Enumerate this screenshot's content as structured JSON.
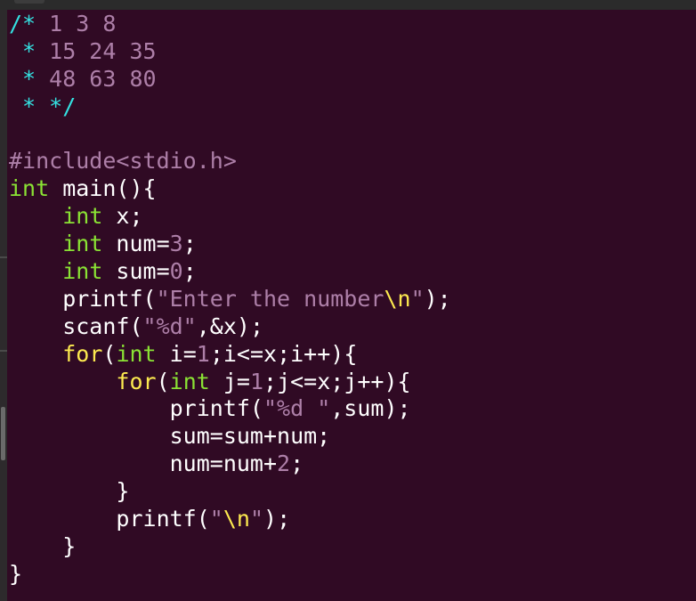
{
  "editor": {
    "lines": [
      [
        {
          "t": "/* ",
          "c": "comment"
        },
        {
          "t": "1 3 8",
          "c": "num"
        }
      ],
      [
        {
          "t": " * ",
          "c": "comment"
        },
        {
          "t": "15 24 35",
          "c": "num"
        }
      ],
      [
        {
          "t": " * ",
          "c": "comment"
        },
        {
          "t": "48 63 80",
          "c": "num"
        }
      ],
      [
        {
          "t": " * */",
          "c": "comment"
        }
      ],
      [
        {
          "t": "",
          "c": "plain"
        }
      ],
      [
        {
          "t": "#include",
          "c": "pre"
        },
        {
          "t": "<stdio.h>",
          "c": "str"
        }
      ],
      [
        {
          "t": "int",
          "c": "kw"
        },
        {
          "t": " main(){",
          "c": "plain"
        }
      ],
      [
        {
          "t": "    ",
          "c": "plain"
        },
        {
          "t": "int",
          "c": "kw"
        },
        {
          "t": " x;",
          "c": "plain"
        }
      ],
      [
        {
          "t": "    ",
          "c": "plain"
        },
        {
          "t": "int",
          "c": "kw"
        },
        {
          "t": " num=",
          "c": "plain"
        },
        {
          "t": "3",
          "c": "num"
        },
        {
          "t": ";",
          "c": "plain"
        }
      ],
      [
        {
          "t": "    ",
          "c": "plain"
        },
        {
          "t": "int",
          "c": "kw"
        },
        {
          "t": " sum=",
          "c": "plain"
        },
        {
          "t": "0",
          "c": "num"
        },
        {
          "t": ";",
          "c": "plain"
        }
      ],
      [
        {
          "t": "    printf(",
          "c": "plain"
        },
        {
          "t": "\"Enter the number",
          "c": "str"
        },
        {
          "t": "\\n",
          "c": "esc"
        },
        {
          "t": "\"",
          "c": "str"
        },
        {
          "t": ");",
          "c": "plain"
        }
      ],
      [
        {
          "t": "    scanf(",
          "c": "plain"
        },
        {
          "t": "\"%d\"",
          "c": "str"
        },
        {
          "t": ",&x);",
          "c": "plain"
        }
      ],
      [
        {
          "t": "    ",
          "c": "plain"
        },
        {
          "t": "for",
          "c": "ctl"
        },
        {
          "t": "(",
          "c": "plain"
        },
        {
          "t": "int",
          "c": "kw"
        },
        {
          "t": " i=",
          "c": "plain"
        },
        {
          "t": "1",
          "c": "num"
        },
        {
          "t": ";i<=x;i++){",
          "c": "plain"
        }
      ],
      [
        {
          "t": "        ",
          "c": "plain"
        },
        {
          "t": "for",
          "c": "ctl"
        },
        {
          "t": "(",
          "c": "plain"
        },
        {
          "t": "int",
          "c": "kw"
        },
        {
          "t": " j=",
          "c": "plain"
        },
        {
          "t": "1",
          "c": "num"
        },
        {
          "t": ";j<=x;j++){",
          "c": "plain"
        }
      ],
      [
        {
          "t": "            printf(",
          "c": "plain"
        },
        {
          "t": "\"%d \"",
          "c": "str"
        },
        {
          "t": ",sum);",
          "c": "plain"
        }
      ],
      [
        {
          "t": "            sum=sum+num;",
          "c": "plain"
        }
      ],
      [
        {
          "t": "            num=num+",
          "c": "plain"
        },
        {
          "t": "2",
          "c": "num"
        },
        {
          "t": ";",
          "c": "plain"
        }
      ],
      [
        {
          "t": "        }",
          "c": "plain"
        }
      ],
      [
        {
          "t": "        printf(",
          "c": "plain"
        },
        {
          "t": "\"",
          "c": "str"
        },
        {
          "t": "\\n",
          "c": "esc"
        },
        {
          "t": "\"",
          "c": "str"
        },
        {
          "t": ");",
          "c": "plain"
        }
      ],
      [
        {
          "t": "    }",
          "c": "plain"
        }
      ],
      [
        {
          "t": "}",
          "c": "plain"
        }
      ]
    ]
  }
}
